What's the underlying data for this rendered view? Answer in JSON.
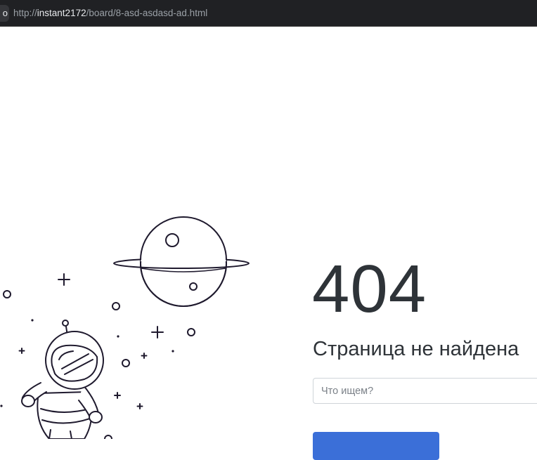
{
  "browser": {
    "edge_tab_glyph": "o",
    "url_scheme": "http://",
    "url_host": "instant2172",
    "url_path": "/board/8-asd-asdasd-ad.html"
  },
  "main": {
    "error_code": "404",
    "title": "Страница не найдена",
    "search_placeholder": "Что ищем?",
    "search_button_label": ""
  },
  "illustration": {
    "icon": "astronaut-planet-illustration",
    "stroke_color": "#1f1a2e"
  },
  "colors": {
    "text": "#2e3338",
    "accent": "#3b6fd8"
  }
}
